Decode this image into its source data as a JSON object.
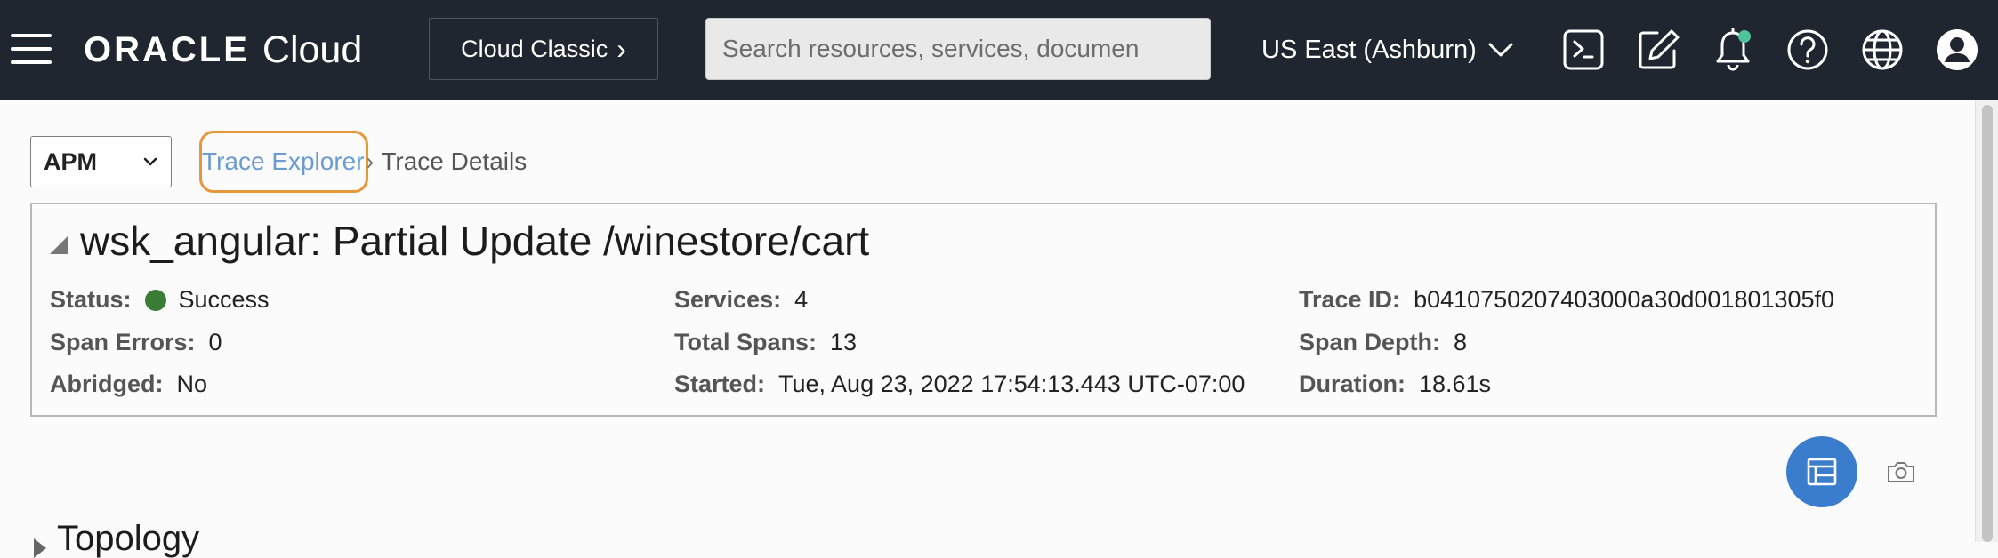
{
  "header": {
    "logo_text": "ORACLE",
    "logo_suffix": "Cloud",
    "classic_label": "Cloud Classic",
    "classic_chevron": "›",
    "search_placeholder": "Search resources, services, documen",
    "region": "US East (Ashburn)",
    "icons": [
      "menu-icon",
      "cloud-shell-icon",
      "edit-icon",
      "bell-icon",
      "help-icon",
      "globe-icon",
      "user-icon"
    ],
    "notification_dot_color": "#4fc39a",
    "background_color": "#1f2630"
  },
  "toolbar": {
    "app_select": "APM"
  },
  "breadcrumb": {
    "link": "Trace Explorer",
    "separator": "›",
    "current": "Trace Details"
  },
  "trace": {
    "title": "wsk_angular: Partial Update /winestore/cart",
    "fields": [
      {
        "label": "Status:",
        "value": "Success"
      },
      {
        "label": "Span Errors:",
        "value": "0"
      },
      {
        "label": "Abridged:",
        "value": "No"
      },
      {
        "label": "Services:",
        "value": "4"
      },
      {
        "label": "Total Spans:",
        "value": "13"
      },
      {
        "label": "Started:",
        "value": "Tue, Aug 23, 2022 17:54:13.443 UTC-07:00"
      },
      {
        "label": "Trace ID:",
        "value": "b0410750207403000a30d001801305f0"
      },
      {
        "label": "Span Depth:",
        "value": "8"
      },
      {
        "label": "Duration:",
        "value": "18.61s"
      }
    ],
    "status_color": "#3a7d35"
  },
  "actions": {
    "hierarchy_button_icon": "hierarchy-icon",
    "hierarchy_button_color": "#3a7dcd",
    "camera_icon": "camera-icon"
  },
  "topology": {
    "label": "Topology"
  }
}
